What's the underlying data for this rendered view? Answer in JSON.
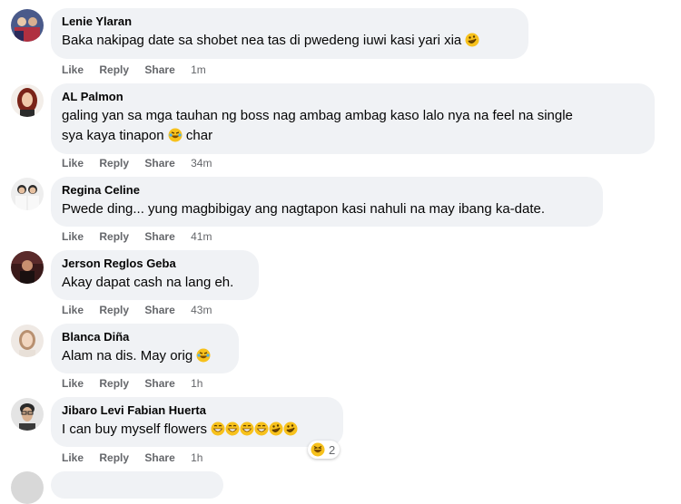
{
  "actions": {
    "like": "Like",
    "reply": "Reply",
    "share": "Share"
  },
  "comments": [
    {
      "name": "Lenie Ylaran",
      "text": "Baka nakipag date sa shobet nea tas di pwedeng iuwi kasi yari xia",
      "time": "1m",
      "emoji": "rofl",
      "avatar": "avatar-group-photo"
    },
    {
      "name": "AL Palmon",
      "text1": "galing yan sa mga tauhan ng boss nag ambag ambag kaso lalo nya na feel na single",
      "text2": "sya kaya tinapon",
      "text2b": "char",
      "time": "34m",
      "emoji": "joy",
      "avatar": "avatar-woman-red-hair"
    },
    {
      "name": "Regina Celine",
      "text": "Pwede ding... yung magbibigay ang nagtapon kasi nahuli na may ibang ka-date.",
      "time": "41m",
      "avatar": "avatar-couple-photo"
    },
    {
      "name": "Jerson Reglos Geba",
      "text": "Akay dapat cash na lang eh.",
      "time": "43m",
      "avatar": "avatar-dark-photo"
    },
    {
      "name": "Blanca Diña",
      "text": "Alam na dis. May orig",
      "time": "1h",
      "emoji": "joy",
      "avatar": "avatar-woman-light"
    },
    {
      "name": "Jibaro Levi Fabian Huerta",
      "text": "I can buy myself flowers",
      "time": "1h",
      "emojis": [
        "grin",
        "grin",
        "grin",
        "grin",
        "rofl",
        "rofl"
      ],
      "reaction_count": "2",
      "reaction_icon": "haha-reaction-icon",
      "avatar": "avatar-man-glasses"
    }
  ],
  "colors": {
    "bubble": "#f0f2f5",
    "meta": "#65676b",
    "text": "#050505",
    "emoji": "#f7c11c"
  }
}
